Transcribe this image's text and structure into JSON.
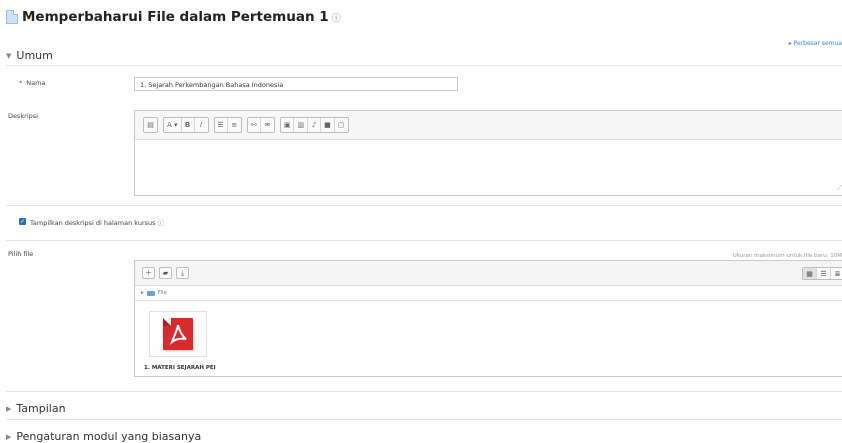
{
  "page": {
    "title": "Memperbaharui File dalam Pertemuan 1",
    "expand_all": "Perbesar semua"
  },
  "sections": {
    "general": "Umum",
    "appearance": "Tampilan",
    "common_settings": "Pengaturan modul yang biasanya"
  },
  "form": {
    "name_label": "Nama",
    "name_value": "1. Sejarah Perkembangan Bahasa Indonesia",
    "description_label": "Deskripsi",
    "show_description_label": "Tampilkan deskripsi di halaman kursus",
    "show_description_checked": true,
    "select_files_label": "Pilih file",
    "max_size_text": "Ukuran maksimum untuk file baru: 10M"
  },
  "editor": {
    "toolbar_groups": [
      [
        "▤"
      ],
      [
        "A ▾",
        "B",
        "I"
      ],
      [
        "☰",
        "≡"
      ],
      [
        "⚯",
        "⚮"
      ],
      [
        "▣",
        "▥",
        "♪",
        "■",
        "▢"
      ]
    ]
  },
  "filepicker": {
    "folder_label": "File",
    "file_name": "1. MATERI SEJARAH PEI"
  },
  "colors": {
    "accent": "#2f6fb7",
    "link": "#3a86c8",
    "pdf_red": "#d92b2b"
  }
}
